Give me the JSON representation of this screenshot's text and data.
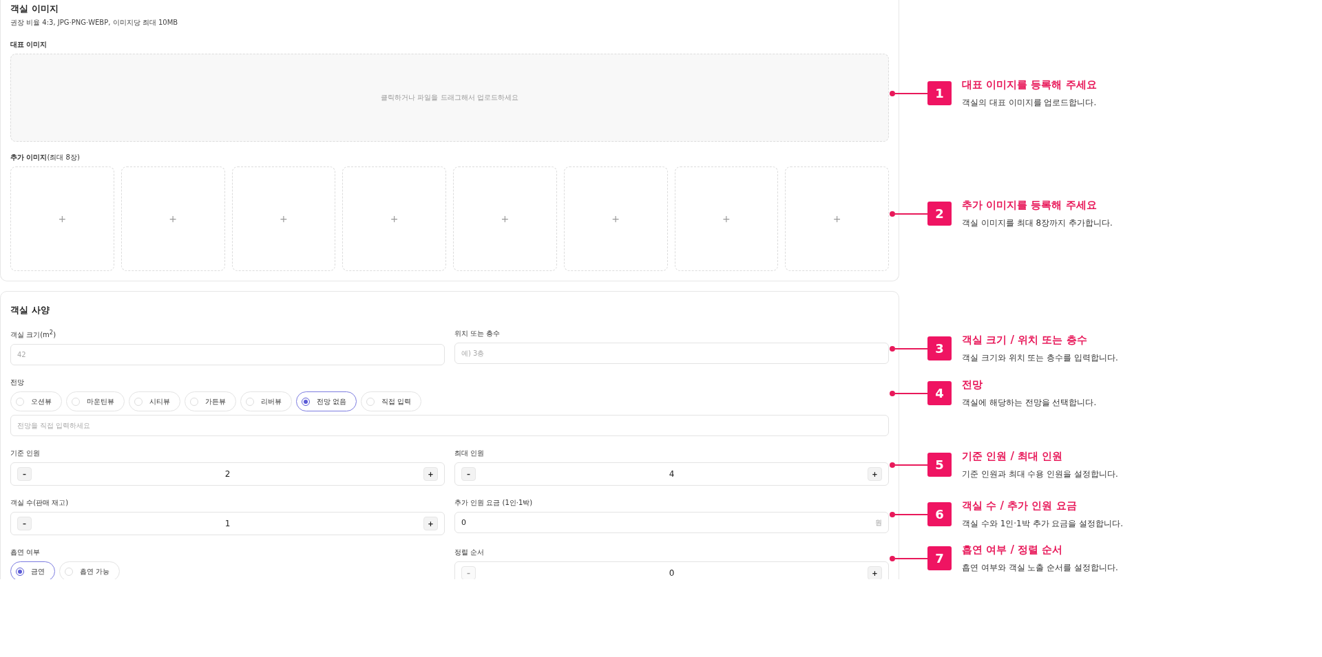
{
  "images": {
    "title": "객실 이미지",
    "hint": "권장 비율 4:3, JPG·PNG·WEBP, 이미지당 최대 10MB",
    "main_label": "대표 이미지",
    "dropzone": "클릭하거나 파일을 드래그해서 업로드하세요",
    "extra_label": "**추가 이미지**(최대 8장)",
    "slots": [
      "+",
      "+",
      "+",
      "+",
      "+",
      "+",
      "+",
      "+"
    ]
  },
  "specs": {
    "title": "객실 사양",
    "fields": [
      {
        "kind": "text",
        "label": "객실 크기(m$^{2}$)",
        "placeholder": "42"
      },
      {
        "kind": "text",
        "label": "위치 또는 층수",
        "placeholder": "예) 3층"
      },
      {
        "kind": "radio",
        "wide": true,
        "label": "전망",
        "options": [
          {
            "label": "오션뷰",
            "selected": false
          },
          {
            "label": "마운틴뷰",
            "selected": false
          },
          {
            "label": "시티뷰",
            "selected": false
          },
          {
            "label": "가든뷰",
            "selected": false
          },
          {
            "label": "리버뷰",
            "selected": false
          },
          {
            "label": "전망 없음",
            "selected": true
          },
          {
            "label": "직접 입력",
            "selected": false
          }
        ],
        "custom_placeholder": "전망을 직접 입력하세요"
      },
      {
        "kind": "stepper",
        "label": "기준 인원",
        "value": "2",
        "minus": "–",
        "plus": "+",
        "minus_disabled": false
      },
      {
        "kind": "stepper",
        "label": "최대 인원",
        "value": "4",
        "minus": "–",
        "plus": "+",
        "minus_disabled": false
      },
      {
        "kind": "stepper",
        "label": "객실 수(판매 재고)",
        "value": "1",
        "minus": "–",
        "plus": "+",
        "minus_disabled": false
      },
      {
        "kind": "money",
        "label": "추가 인원 요금 (1인·1박)",
        "value": "0",
        "unit": "원"
      },
      {
        "kind": "radio",
        "wide": false,
        "label": "흡연 여부",
        "options": [
          {
            "label": "금연",
            "selected": true
          },
          {
            "label": "흡연 가능",
            "selected": false
          }
        ]
      },
      {
        "kind": "stepper",
        "label": "정렬 순서",
        "value": "0",
        "minus": "–",
        "plus": "+",
        "minus_disabled": true
      }
    ]
  },
  "callouts": [
    {
      "number": "1",
      "title": "대표 이미지를 등록해 주세요",
      "text": "객실의 대표 이미지를 업로드합니다."
    },
    {
      "number": "2",
      "title": "추가 이미지를 등록해 주세요",
      "text": "객실 이미지를 최대 8장까지 추가합니다."
    },
    {
      "number": "3",
      "title": "객실 크기 / 위치 또는 층수",
      "text": "객실 크기와 위치 또는 층수를 입력합니다."
    },
    {
      "number": "4",
      "title": "전망",
      "text": "객실에 해당하는 전망을 선택합니다."
    },
    {
      "number": "5",
      "title": "기준 인원 / 최대 인원",
      "text": "기준 인원과 최대 수용 인원을 설정합니다."
    },
    {
      "number": "6",
      "title": "객실 수 / 추가 인원 요금",
      "text": "객실 수와 1인·1박 추가 요금을 설정합니다."
    },
    {
      "number": "7",
      "title": "흡연 여부 / 정렬 순서",
      "text": "흡연 여부와 객실 노출 순서를 설정합니다."
    }
  ]
}
